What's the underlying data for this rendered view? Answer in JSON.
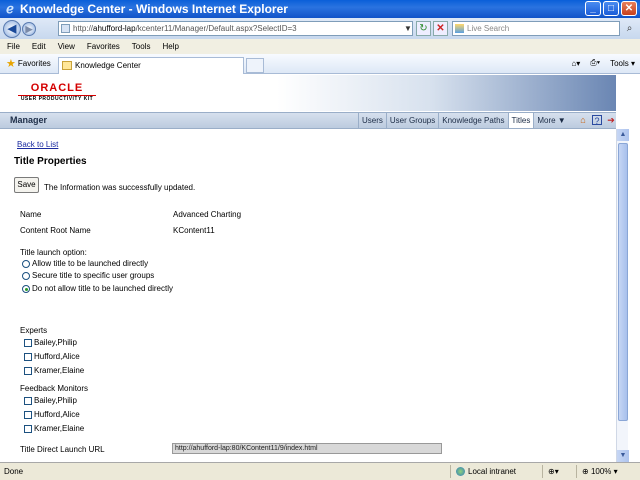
{
  "window": {
    "title": "Knowledge Center - Windows Internet Explorer",
    "minimize": "_",
    "maximize": "□",
    "close": "✕"
  },
  "address": {
    "url_prefix": "http://",
    "url_host": "ahufford-lap",
    "url_path": "/kcenter11/Manager/Default.aspx?SelectID=3",
    "search_placeholder": "Live Search"
  },
  "menu": [
    "File",
    "Edit",
    "View",
    "Favorites",
    "Tools",
    "Help"
  ],
  "favorites": {
    "label": "Favorites",
    "tab_title": "Knowledge Center",
    "tools_label": "Tools"
  },
  "brand": {
    "name": "ORACLE",
    "product": "USER PRODUCTIVITY KIT"
  },
  "manager": {
    "title": "Manager",
    "nav": [
      "Users",
      "User Groups",
      "Knowledge Paths",
      "Titles",
      "More ▼"
    ]
  },
  "page": {
    "back_link": "Back to List",
    "title": "Title Properties",
    "save_label": "Save",
    "message": "The Information was successfully updated."
  },
  "properties": {
    "name_label": "Name",
    "name_value": "Advanced Charting",
    "root_label": "Content Root Name",
    "root_value": "KContent11",
    "launch_label": "Title launch option:",
    "launch_options": [
      "Allow title to be launched directly",
      "Secure title to specific user groups",
      "Do not allow title to be launched directly"
    ],
    "launch_selected": 2,
    "experts_label": "Experts",
    "experts": [
      "Bailey,Philip",
      "Hufford,Alice",
      "Kramer,Elaine"
    ],
    "monitors_label": "Feedback Monitors",
    "monitors": [
      "Bailey,Philip",
      "Hufford,Alice",
      "Kramer,Elaine"
    ],
    "url_label": "Title Direct Launch URL",
    "url_value": "http://ahufford-lap:80/KContent11/9/index.html"
  },
  "status": {
    "text": "Done",
    "zone": "Local intranet",
    "zoom": "100%"
  }
}
